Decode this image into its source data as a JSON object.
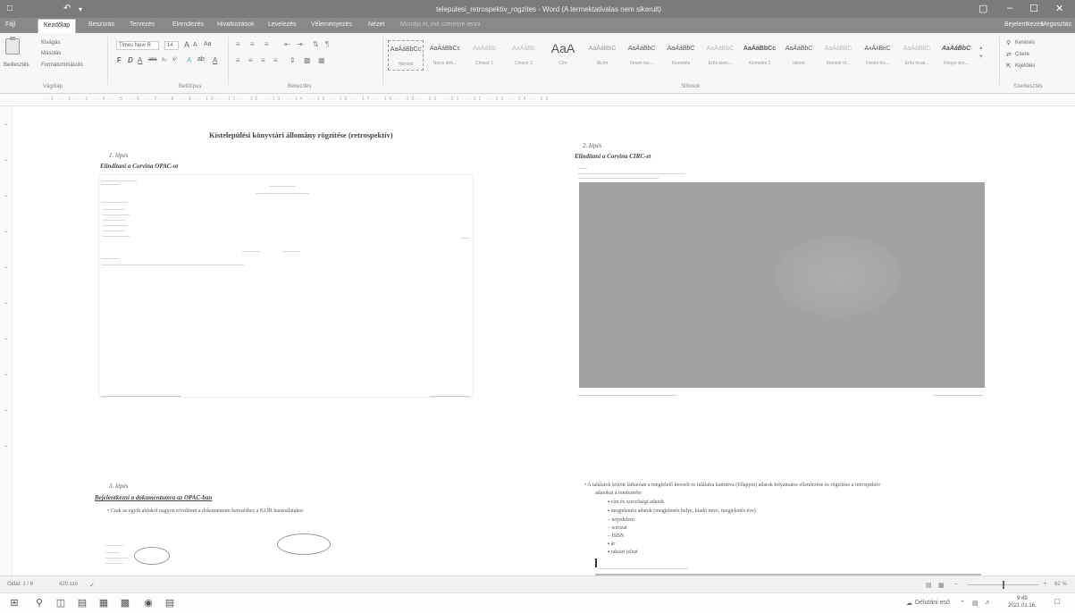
{
  "window": {
    "title": "telepulesi_retrospektiv_rogzites - Word (A termektativalas nem sikerult)",
    "undo_icon": "undo-icon",
    "save_icon": "save-icon",
    "controls": [
      "–",
      "☐",
      "✕"
    ]
  },
  "ribbon_tabs": {
    "items": [
      "Fájl",
      "Kezdőlap",
      "Beszúrás",
      "Tervezés",
      "Elrendezés",
      "Hivatkozások",
      "Levelezés",
      "Véleményezés",
      "Nézet"
    ],
    "active_index": 1,
    "tell_me": "Mondja el, mit szeretne tenni",
    "sign_in": "Bejelentkezés",
    "share": "Megosztás"
  },
  "ribbon": {
    "clipboard": {
      "paste": "Beillesztés",
      "cut": "Kivágás",
      "copy": "Másolás",
      "format_painter": "Formátummásoló",
      "label": "Vágólap"
    },
    "font": {
      "name": "Times New R",
      "size": "14",
      "label": "Betűtípus",
      "grow": "A",
      "shrink": "A",
      "case": "Aa",
      "bold": "F",
      "italic": "D",
      "underline": "A",
      "strike": "abc",
      "subscript": "x₂",
      "superscript": "x²",
      "text_effects": "A",
      "highlight": "ab",
      "font_color": "A"
    },
    "paragraph": {
      "label": "Bekezdés"
    },
    "styles": {
      "label": "Stílusok",
      "items": [
        {
          "preview": "AaÁáBbCc",
          "name": "Normál"
        },
        {
          "preview": "AaÁáBbCc",
          "name": "Nincs térk..."
        },
        {
          "preview": "AaÁáBb",
          "name": "Címsor 1"
        },
        {
          "preview": "AaÁáBb",
          "name": "Címsor 2"
        },
        {
          "preview": "AaA",
          "name": "Cím"
        },
        {
          "preview": "AaÁáBbC",
          "name": "Alcím"
        },
        {
          "preview": "AaÁáBbC",
          "name": "Finom kie..."
        },
        {
          "preview": "AaÁáBbC",
          "name": "Kiemelés"
        },
        {
          "preview": "AaÁáBbC",
          "name": "Erős kiem..."
        },
        {
          "preview": "AaÁáBbCc",
          "name": "Kiemelés 2"
        },
        {
          "preview": "AaÁáBbC",
          "name": "Idézet"
        },
        {
          "preview": "AaÁáBbC",
          "name": "Kiemelt id..."
        },
        {
          "preview": "AaÁáBbC",
          "name": "Finom hiv..."
        },
        {
          "preview": "AaÁáBbC",
          "name": "Erős hivat..."
        },
        {
          "preview": "AaÁáBbC",
          "name": "Könyv cím..."
        }
      ]
    },
    "editing": {
      "find": "Keresés",
      "replace": "Csere",
      "select": "Kijelölés",
      "label": "Szerkesztés"
    }
  },
  "document": {
    "page1": {
      "title": "Kistelepülési könyvtári állomány rögzítése (retrospektív)",
      "step1_num": "1. lépés",
      "step1_head": "Elindítani a Corvina OPAC-ot",
      "step3_num": "3. lépés",
      "step3_head": "Bejelentkezni a dokumentumra az OPAC-ban",
      "step3_bullet": "Csak az egyik ablakot nagyon rövidíteni a dokumentum kereséshez a KLÍR használatakor"
    },
    "page2": {
      "step2_num": "2. lépés",
      "step2_head": "Elindítani a Corvina CIRC-et",
      "step4_intro": "A találatok között láthatóan a megfelelő keresőt és találatra kattintva (főlapjon) adatok folyamatos ellenőrzése és rögzítése a retrospektív",
      "step4_intro2": "adatokat a rendszerbe",
      "bullets": [
        "cím és szerzőségi adatok",
        "megjelenési adatok (megjelenés helye, kiadó neve, megjelenés éve)",
        "terjedelem",
        "sorozat",
        "ISBN",
        "ár",
        "raktári jelzet"
      ]
    }
  },
  "statusbar": {
    "page": "Oldal: 1 / 6",
    "words": "420 szó",
    "zoom": "62 %",
    "zoom_minus": "–",
    "zoom_plus": "+"
  },
  "taskbar": {
    "weather": "Délutáni eső",
    "time": "9:49",
    "date": "2021.01.16."
  }
}
